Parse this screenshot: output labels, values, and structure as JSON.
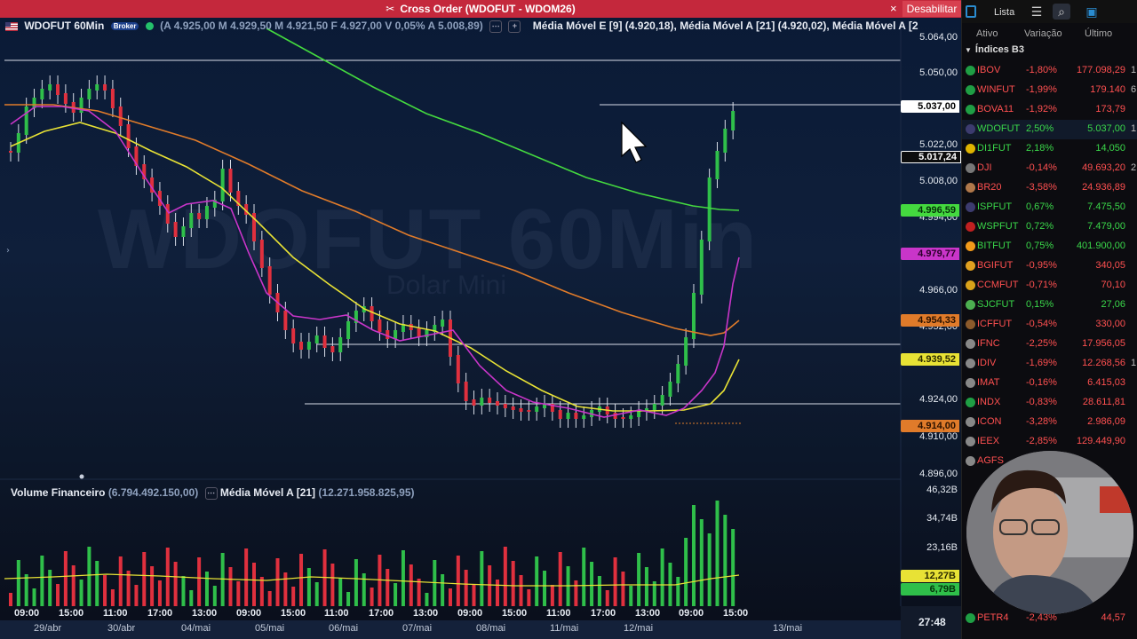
{
  "order_bar": {
    "icon": "tools-icon",
    "title": "Cross Order (WDOFUT - WDOM26)",
    "close": "×",
    "disable_label": "Desabilitar"
  },
  "chart": {
    "symbol": "WDOFUT 60Min",
    "broker_chip": "Broker",
    "ohlc_label": "(A 4.925,00 M 4.929,50 M 4.921,50 F 4.927,00 V 0,05% A 5.008,89)",
    "ma1": "Média Móvel E [9] (4.920,18),",
    "ma2": "Média Móvel A [21] (4.920,02),",
    "ma3": "Média Móvel A [2",
    "watermark": "WDOFUT 60Min",
    "watermark_sub": "Dolar Mini",
    "colors": {
      "up": "#2fbf4a",
      "down": "#e0303e",
      "ema9": "#c935c9",
      "sma21": "#e8e235",
      "ma_orange": "#e07b2a",
      "ma_green": "#44d93f"
    },
    "price_axis": [
      "5.064,00",
      "5.050,00",
      "5.022,00",
      "5.008,00",
      "4.994,00",
      "4.966,00",
      "4.952,00",
      "4.924,00",
      "4.910,00",
      "4.896,00"
    ],
    "tags": {
      "last": "5.037,00",
      "level": "5.017,24",
      "green": "4.996,59",
      "magenta": "4.979,77",
      "orange": "4.954,33",
      "yellow": "4.939,52",
      "ref": "4.914,00"
    }
  },
  "volume": {
    "title": "Volume Financeiro",
    "value": "(6.794.492.150,00)",
    "ma_title": "Média Móvel A [21]",
    "ma_value": "(12.271.958.825,95)",
    "axis": [
      "46,32B",
      "34,74B",
      "23,16B"
    ],
    "tag_ma": "12,27B",
    "tag_vol": "6,79B"
  },
  "time_axis": [
    "09:00",
    "15:00",
    "11:00",
    "17:00",
    "13:00",
    "09:00",
    "15:00",
    "11:00",
    "17:00",
    "13:00",
    "09:00",
    "15:00",
    "11:00",
    "17:00",
    "13:00",
    "09:00",
    "15:00"
  ],
  "dates": [
    "29/abr",
    "30/abr",
    "04/mai",
    "05/mai",
    "06/mai",
    "07/mai",
    "08/mai",
    "11/mai",
    "12/mai",
    "13/mai"
  ],
  "clock": "27:48",
  "panel": {
    "list_label": "Lista",
    "col_ativo": "Ativo",
    "col_variacao": "Variação",
    "col_ultimo": "Último",
    "group": "Índices B3",
    "rows": [
      {
        "tk": "IBOV",
        "ch": "-1,80%",
        "lp": "177.098,29",
        "xx": "1",
        "c": "#ff5050",
        "ico": "#1f9e44"
      },
      {
        "tk": "WINFUT",
        "ch": "-1,99%",
        "lp": "179.140",
        "xx": "6",
        "c": "#ff5050",
        "ico": "#1f9e44"
      },
      {
        "tk": "BOVA11",
        "ch": "-1,92%",
        "lp": "173,79",
        "xx": "",
        "c": "#ff5050",
        "ico": "#1f9e44"
      },
      {
        "tk": "WDOFUT",
        "ch": "2,50%",
        "lp": "5.037,00",
        "xx": "1",
        "c": "#3ad84a",
        "ico": "#3c3b6e"
      },
      {
        "tk": "DI1FUT",
        "ch": "2,18%",
        "lp": "14,050",
        "xx": "",
        "c": "#3ad84a",
        "ico": "#e0b400"
      },
      {
        "tk": "DJI",
        "ch": "-0,14%",
        "lp": "49.693,20",
        "xx": "2",
        "c": "#ff5050",
        "ico": "#777"
      },
      {
        "tk": "BR20",
        "ch": "-3,58%",
        "lp": "24.936,89",
        "xx": "",
        "c": "#ff5050",
        "ico": "#b0784a"
      },
      {
        "tk": "ISPFUT",
        "ch": "0,67%",
        "lp": "7.475,50",
        "xx": "",
        "c": "#3ad84a",
        "ico": "#3c3b6e"
      },
      {
        "tk": "WSPFUT",
        "ch": "0,72%",
        "lp": "7.479,00",
        "xx": "",
        "c": "#3ad84a",
        "ico": "#c02020"
      },
      {
        "tk": "BITFUT",
        "ch": "0,75%",
        "lp": "401.900,00",
        "xx": "",
        "c": "#3ad84a",
        "ico": "#f29a1a"
      },
      {
        "tk": "BGIFUT",
        "ch": "-0,95%",
        "lp": "340,05",
        "xx": "",
        "c": "#ff5050",
        "ico": "#e0a020"
      },
      {
        "tk": "CCMFUT",
        "ch": "-0,71%",
        "lp": "70,10",
        "xx": "",
        "c": "#ff5050",
        "ico": "#d9a21a"
      },
      {
        "tk": "SJCFUT",
        "ch": "0,15%",
        "lp": "27,06",
        "xx": "",
        "c": "#3ad84a",
        "ico": "#4caf50"
      },
      {
        "tk": "ICFFUT",
        "ch": "-0,54%",
        "lp": "330,00",
        "xx": "",
        "c": "#ff5050",
        "ico": "#8b5a2b"
      },
      {
        "tk": "IFNC",
        "ch": "-2,25%",
        "lp": "17.956,05",
        "xx": "",
        "c": "#ff5050",
        "ico": "#888"
      },
      {
        "tk": "IDIV",
        "ch": "-1,69%",
        "lp": "12.268,56",
        "xx": "1",
        "c": "#ff5050",
        "ico": "#888"
      },
      {
        "tk": "IMAT",
        "ch": "-0,16%",
        "lp": "6.415,03",
        "xx": "",
        "c": "#ff5050",
        "ico": "#888"
      },
      {
        "tk": "INDX",
        "ch": "-0,83%",
        "lp": "28.611,81",
        "xx": "",
        "c": "#ff5050",
        "ico": "#1f9e44"
      },
      {
        "tk": "ICON",
        "ch": "-3,28%",
        "lp": "2.986,09",
        "xx": "",
        "c": "#ff5050",
        "ico": "#888"
      },
      {
        "tk": "IEEX",
        "ch": "-2,85%",
        "lp": "129.449,90",
        "xx": "",
        "c": "#ff5050",
        "ico": "#888"
      },
      {
        "tk": "AGFS",
        "ch": "",
        "lp": "",
        "xx": "",
        "c": "#ff5050",
        "ico": "#888"
      }
    ],
    "bottom_rows": [
      {
        "tk": "PETR4",
        "ch": "-2,43%",
        "lp": "44,57",
        "c": "#ff5050"
      }
    ]
  }
}
